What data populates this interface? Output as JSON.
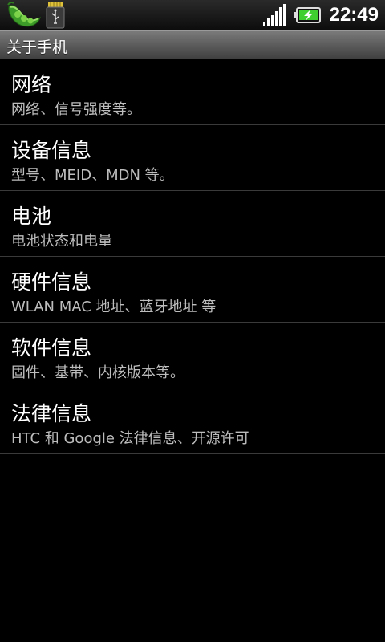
{
  "status_bar": {
    "left_icons": [
      "pea-app-icon",
      "sdcard-usb-icon"
    ],
    "signal_icon": "signal-strength-icon",
    "battery_icon": "battery-charging-icon",
    "time": "22:49"
  },
  "header": {
    "title": "关于手机"
  },
  "list": {
    "items": [
      {
        "title": "网络",
        "summary": "网络、信号强度等。"
      },
      {
        "title": "设备信息",
        "summary": "型号、MEID、MDN 等。"
      },
      {
        "title": "电池",
        "summary": "电池状态和电量"
      },
      {
        "title": "硬件信息",
        "summary": "WLAN MAC 地址、蓝牙地址 等"
      },
      {
        "title": "软件信息",
        "summary": "固件、基带、内核版本等。"
      },
      {
        "title": "法律信息",
        "summary": "HTC 和 Google 法律信息、开源许可"
      }
    ]
  },
  "colors": {
    "background": "#000000",
    "title_bar": "#5e5e5e",
    "summary_text": "#bdbdbd",
    "battery_charge": "#3fcf2f"
  }
}
